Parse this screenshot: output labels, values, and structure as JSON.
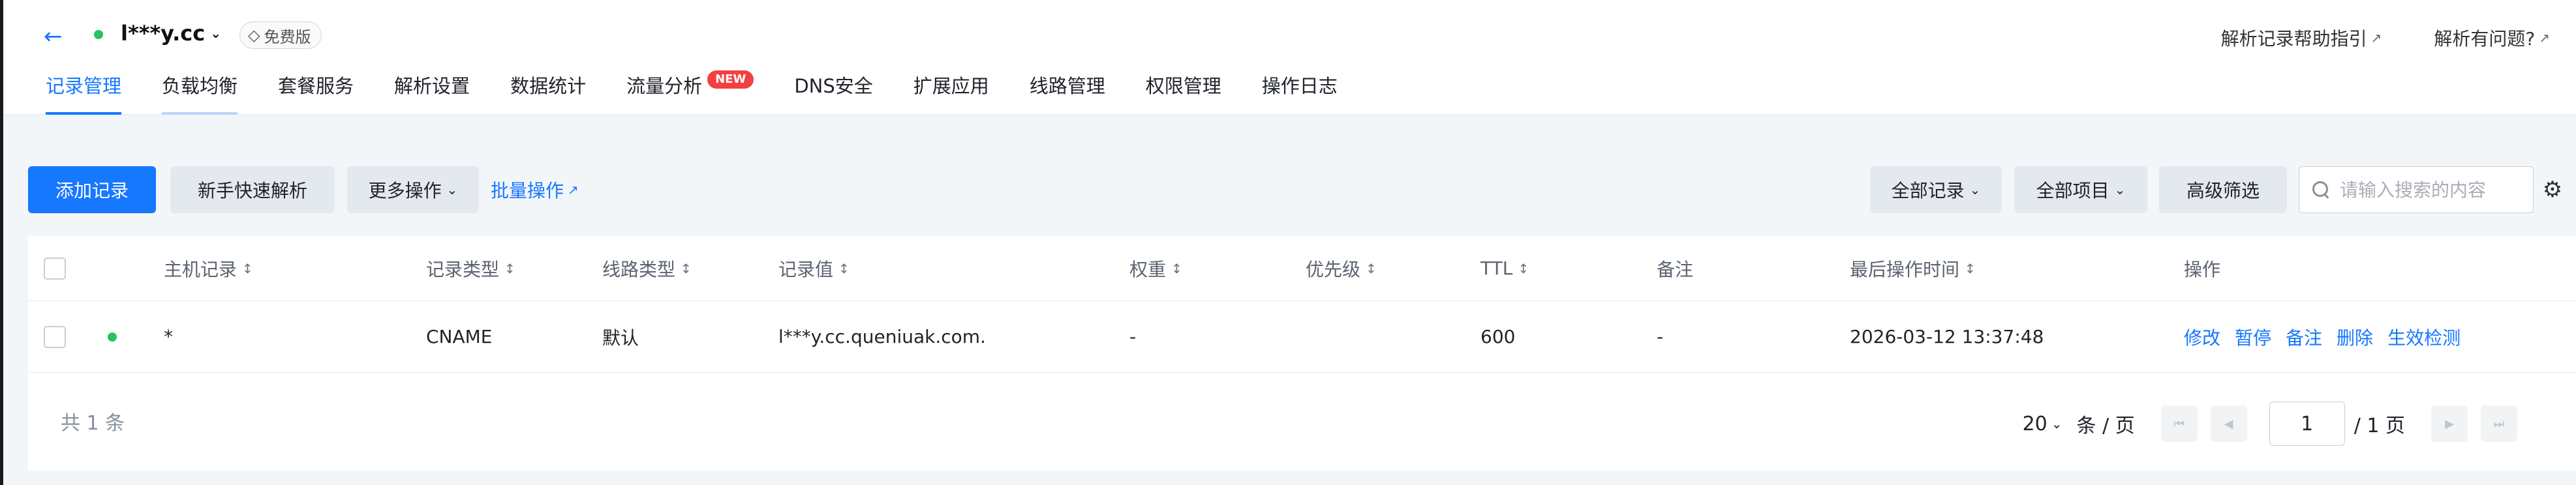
{
  "header": {
    "domain": "l***y.cc",
    "plan_badge": "免费版",
    "help_link": "解析记录帮助指引",
    "problem_link": "解析有问题?"
  },
  "tabs": [
    {
      "label": "记录管理",
      "active": true
    },
    {
      "label": "负载均衡",
      "active": false
    },
    {
      "label": "套餐服务",
      "active": false
    },
    {
      "label": "解析设置",
      "active": false
    },
    {
      "label": "数据统计",
      "active": false
    },
    {
      "label": "流量分析",
      "active": false,
      "badge": "NEW"
    },
    {
      "label": "DNS安全",
      "active": false
    },
    {
      "label": "扩展应用",
      "active": false
    },
    {
      "label": "线路管理",
      "active": false
    },
    {
      "label": "权限管理",
      "active": false
    },
    {
      "label": "操作日志",
      "active": false
    }
  ],
  "toolbar": {
    "add_record": "添加记录",
    "quick_setup": "新手快速解析",
    "more_actions": "更多操作",
    "batch_ops": "批量操作",
    "all_records": "全部记录",
    "all_items": "全部项目",
    "advanced_filter": "高级筛选",
    "search_placeholder": "请输入搜索的内容"
  },
  "table": {
    "columns": {
      "host": "主机记录",
      "type": "记录类型",
      "line": "线路类型",
      "value": "记录值",
      "weight": "权重",
      "priority": "优先级",
      "ttl": "TTL",
      "remark": "备注",
      "last_op_time": "最后操作时间",
      "actions": "操作"
    },
    "rows": [
      {
        "host": "*",
        "type": "CNAME",
        "line": "默认",
        "value": "l***y.cc.queniuak.com.",
        "weight": "-",
        "priority": "",
        "ttl": "600",
        "remark": "-",
        "last_op_time": "2026-03-12 13:37:48",
        "actions": {
          "modify": "修改",
          "pause": "暂停",
          "remark": "备注",
          "delete": "删除",
          "check": "生效检测"
        }
      }
    ]
  },
  "pagination": {
    "total_text": "共 1 条",
    "page_size": "20",
    "per_page_unit": "条 / 页",
    "current_page": "1",
    "total_pages_text": "/ 1 页"
  },
  "colors": {
    "primary": "#1677ff",
    "status_green": "#22c55e",
    "new_badge": "#f53f3f"
  }
}
